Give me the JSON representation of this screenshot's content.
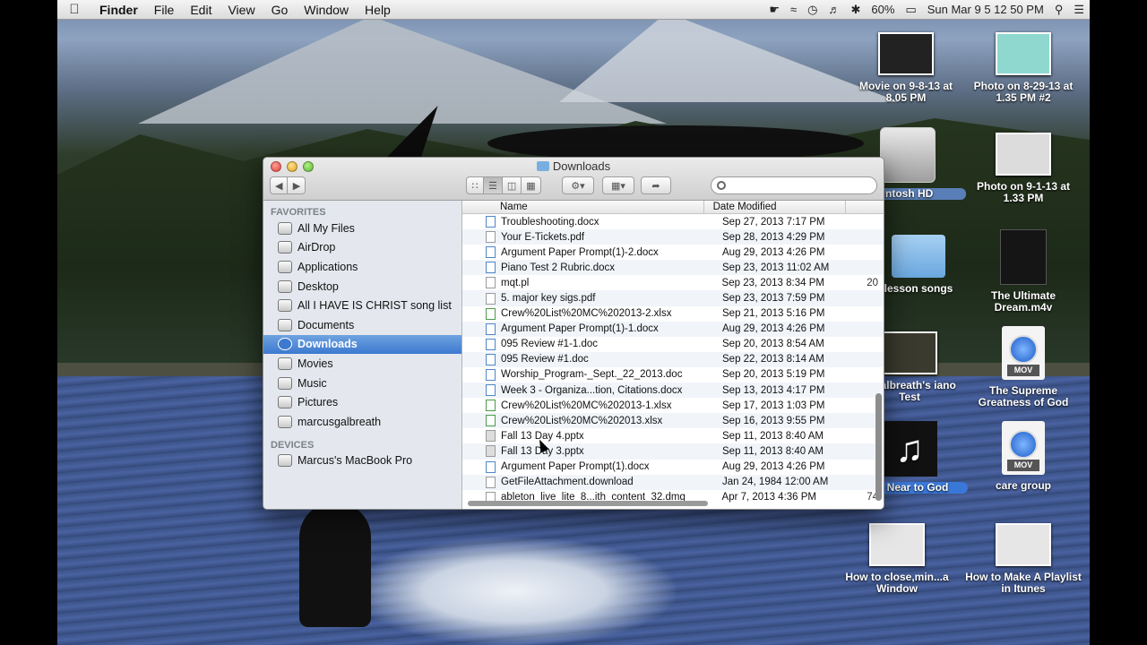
{
  "menubar": {
    "app": "Finder",
    "menus": [
      "File",
      "Edit",
      "View",
      "Go",
      "Window",
      "Help"
    ],
    "battery": "60%",
    "clock": "Sun Mar 9  5 12 50 PM"
  },
  "desktop_icons": [
    {
      "label": "Movie on 9-8-13 at 8.05 PM",
      "kind": "thumb"
    },
    {
      "label": "Photo on 8-29-13 at 1.35 PM #2",
      "kind": "thumb"
    },
    {
      "label": "intosh HD",
      "kind": "hd"
    },
    {
      "label": "Photo on 9-1-13 at 1.33 PM",
      "kind": "thumb"
    },
    {
      "label": "lesson songs",
      "kind": "folder"
    },
    {
      "label": "The Ultimate Dream.m4v",
      "kind": "poster"
    },
    {
      "label": "s Galbreath's iano Test",
      "kind": "thumb"
    },
    {
      "label": "The Supreme Greatness of God",
      "kind": "mov"
    },
    {
      "label": "ng Near to God",
      "kind": "music"
    },
    {
      "label": "care group",
      "kind": "mov"
    },
    {
      "label": "How to close,min...a Window",
      "kind": "thumb"
    },
    {
      "label": "How to Make A Playlist in Itunes",
      "kind": "thumb"
    }
  ],
  "file_badge": "MOV",
  "window": {
    "title": "Downloads",
    "search_placeholder": "",
    "sidebar": {
      "favorites_header": "FAVORITES",
      "favorites": [
        "All My Files",
        "AirDrop",
        "Applications",
        "Desktop",
        "All I HAVE IS CHRIST song list",
        "Documents",
        "Downloads",
        "Movies",
        "Music",
        "Pictures",
        "marcusgalbreath"
      ],
      "selected": "Downloads",
      "devices_header": "DEVICES",
      "devices": [
        "Marcus's MacBook Pro"
      ]
    },
    "columns": {
      "name": "Name",
      "date": "Date Modified"
    },
    "files": [
      {
        "name": "Troubleshooting.docx",
        "date": "Sep 27, 2013 7:17 PM",
        "type": "doc",
        "extra": ""
      },
      {
        "name": "Your E-Tickets.pdf",
        "date": "Sep 28, 2013 4:29 PM",
        "type": "pdf",
        "extra": ""
      },
      {
        "name": "Argument Paper Prompt(1)-2.docx",
        "date": "Aug 29, 2013 4:26 PM",
        "type": "doc",
        "extra": ""
      },
      {
        "name": "Piano Test 2 Rubric.docx",
        "date": "Sep 23, 2013 11:02 AM",
        "type": "doc",
        "extra": ""
      },
      {
        "name": "mqt.pl",
        "date": "Sep 23, 2013 8:34 PM",
        "type": "txt",
        "extra": "20"
      },
      {
        "name": "5. major key sigs.pdf",
        "date": "Sep 23, 2013 7:59 PM",
        "type": "pdf",
        "extra": ""
      },
      {
        "name": "Crew%20List%20MC%202013-2.xlsx",
        "date": "Sep 21, 2013 5:16 PM",
        "type": "xls",
        "extra": ""
      },
      {
        "name": "Argument Paper Prompt(1)-1.docx",
        "date": "Aug 29, 2013 4:26 PM",
        "type": "doc",
        "extra": ""
      },
      {
        "name": "095 Review #1-1.doc",
        "date": "Sep 20, 2013 8:54 AM",
        "type": "doc",
        "extra": ""
      },
      {
        "name": "095 Review #1.doc",
        "date": "Sep 22, 2013 8:14 AM",
        "type": "doc",
        "extra": ""
      },
      {
        "name": "Worship_Program-_Sept._22_2013.doc",
        "date": "Sep 20, 2013 5:19 PM",
        "type": "doc",
        "extra": ""
      },
      {
        "name": "Week 3 - Organiza...tion, Citations.docx",
        "date": "Sep 13, 2013 4:17 PM",
        "type": "doc",
        "extra": ""
      },
      {
        "name": "Crew%20List%20MC%202013-1.xlsx",
        "date": "Sep 17, 2013 1:03 PM",
        "type": "xls",
        "extra": ""
      },
      {
        "name": "Crew%20List%20MC%202013.xlsx",
        "date": "Sep 16, 2013 9:55 PM",
        "type": "xls",
        "extra": ""
      },
      {
        "name": "Fall 13 Day 4.pptx",
        "date": "Sep 11, 2013 8:40 AM",
        "type": "ppt",
        "extra": ""
      },
      {
        "name": "Fall 13 Day 3.pptx",
        "date": "Sep 11, 2013 8:40 AM",
        "type": "ppt",
        "extra": ""
      },
      {
        "name": "Argument Paper Prompt(1).docx",
        "date": "Aug 29, 2013 4:26 PM",
        "type": "doc",
        "extra": ""
      },
      {
        "name": "GetFileAttachment.download",
        "date": "Jan 24, 1984 12:00 AM",
        "type": "dl",
        "extra": ""
      },
      {
        "name": "ableton_live_lite_8...ith_content_32.dmg",
        "date": "Apr 7, 2013 4:36 PM",
        "type": "dmg",
        "extra": "74"
      }
    ]
  }
}
